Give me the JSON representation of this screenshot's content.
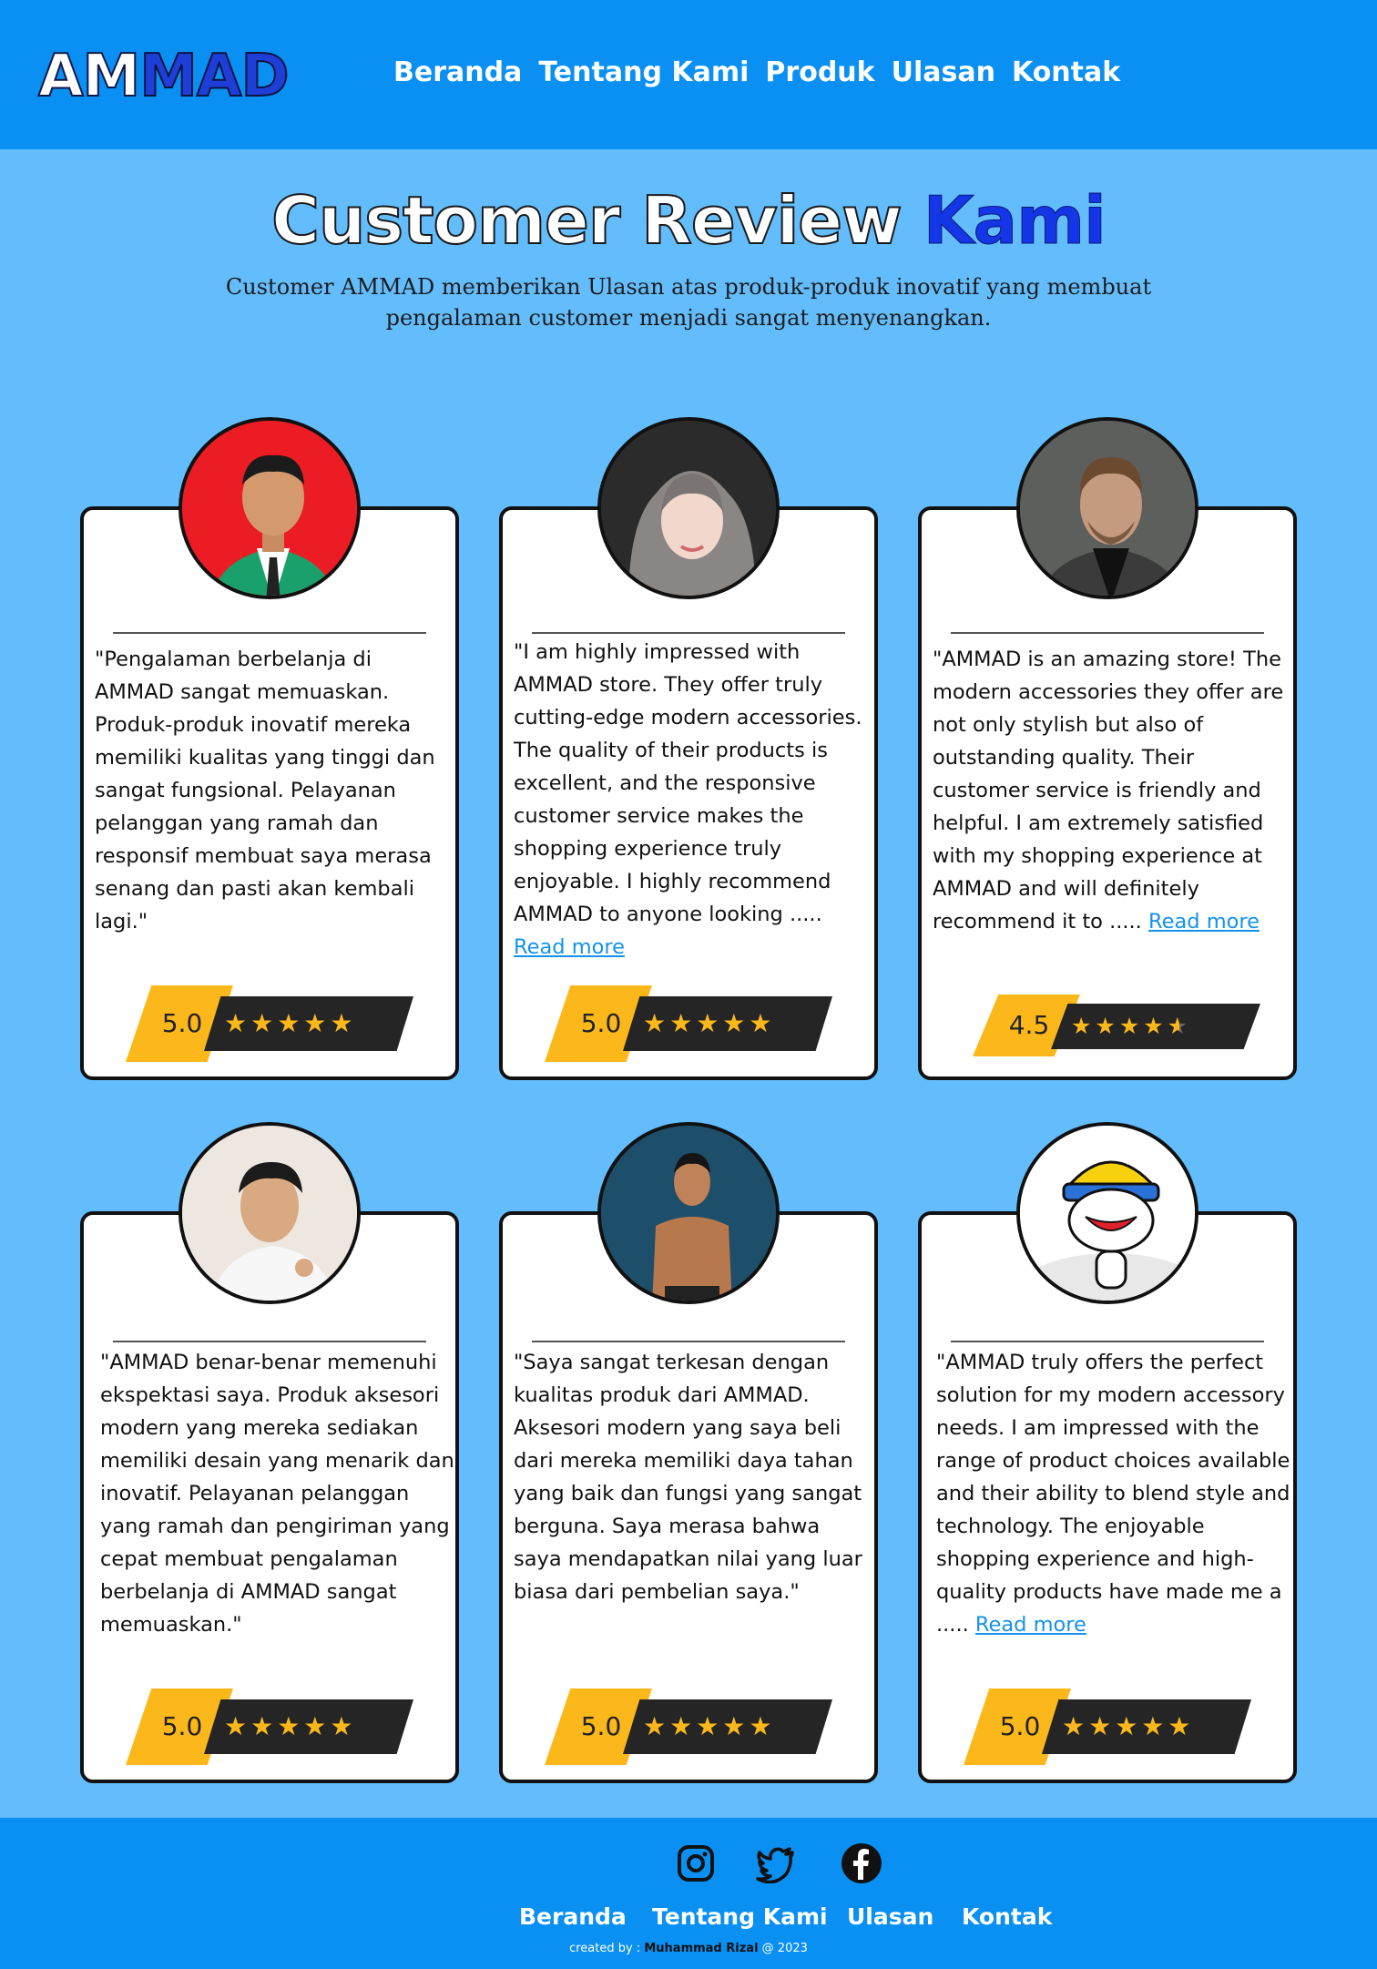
{
  "header": {
    "logo_part1": "AM",
    "logo_part2": "MAD",
    "nav": [
      "Beranda",
      "Tentang Kami",
      "Produk",
      "Ulasan",
      "Kontak"
    ]
  },
  "hero": {
    "title_part1": "Customer Review",
    "title_part2": "Kami",
    "subtitle_line1": "Customer AMMAD memberikan Ulasan atas produk-produk inovatif yang  membuat",
    "subtitle_line2": "pengalaman customer menjadi sangat menyenangkan."
  },
  "reviews": [
    {
      "text": "\"Pengalaman berbelanja di AMMAD sangat memuaskan. Produk-produk inovatif mereka memiliki kualitas yang tinggi dan sangat fungsional. Pelayanan pelanggan yang ramah dan responsif membuat saya merasa senang dan pasti akan kembali lagi.\"",
      "more": "",
      "score": "5.0",
      "rating": 5.0,
      "stars": "★★★★★"
    },
    {
      "text": "\"I am highly impressed with AMMAD store. They offer truly cutting-edge modern accessories. The quality of their products is excellent, and the responsive customer service makes the shopping experience truly enjoyable. I highly recommend AMMAD to anyone looking ..... ",
      "more": "Read more",
      "score": "5.0",
      "rating": 5.0,
      "stars": "★★★★★"
    },
    {
      "text": "\"AMMAD is an amazing store! The modern accessories they offer are not only stylish but also of outstanding quality. Their customer service is friendly and helpful. I am extremely satisfied with my shopping experience at AMMAD and will definitely recommend it to ..... ",
      "more": "Read more",
      "score": "4.5",
      "rating": 4.5,
      "stars": "★★★★"
    },
    {
      "text": "\"AMMAD benar-benar memenuhi ekspektasi saya. Produk aksesori modern yang mereka sediakan memiliki desain yang menarik dan inovatif. Pelayanan pelanggan yang ramah dan pengiriman yang cepat membuat pengalaman berbelanja di AMMAD sangat memuaskan.\"",
      "more": "",
      "score": "5.0",
      "rating": 5.0,
      "stars": "★★★★★"
    },
    {
      "text": "\"Saya sangat terkesan dengan kualitas produk dari AMMAD. Aksesori modern yang saya beli dari mereka memiliki daya tahan yang baik dan fungsi yang sangat berguna. Saya merasa bahwa saya mendapatkan nilai yang luar biasa dari pembelian saya.\"",
      "more": "",
      "score": "5.0",
      "rating": 5.0,
      "stars": "★★★★★"
    },
    {
      "text": "\"AMMAD truly offers the perfect solution for my modern accessory needs. I am impressed with the range of product choices available and their ability to blend style and technology. The enjoyable shopping experience and high-quality products have made me a ..... ",
      "more": "Read more",
      "score": "5.0",
      "rating": 5.0,
      "stars": "★★★★★"
    }
  ],
  "footer": {
    "nav": [
      "Beranda",
      "Tentang Kami",
      "Ulasan",
      "Kontak"
    ],
    "social": [
      "instagram-icon",
      "twitter-icon",
      "facebook-icon"
    ],
    "credit_prefix": "created by : ",
    "credit_name": "Muhammad Rizal",
    "credit_suffix": " @ 2023"
  },
  "colors": {
    "header_bg": "#0990f2",
    "page_bg": "#63bdfd",
    "accent_blue": "#1436e6",
    "star_yellow": "#fcb81a",
    "link_blue": "#1592e8"
  }
}
